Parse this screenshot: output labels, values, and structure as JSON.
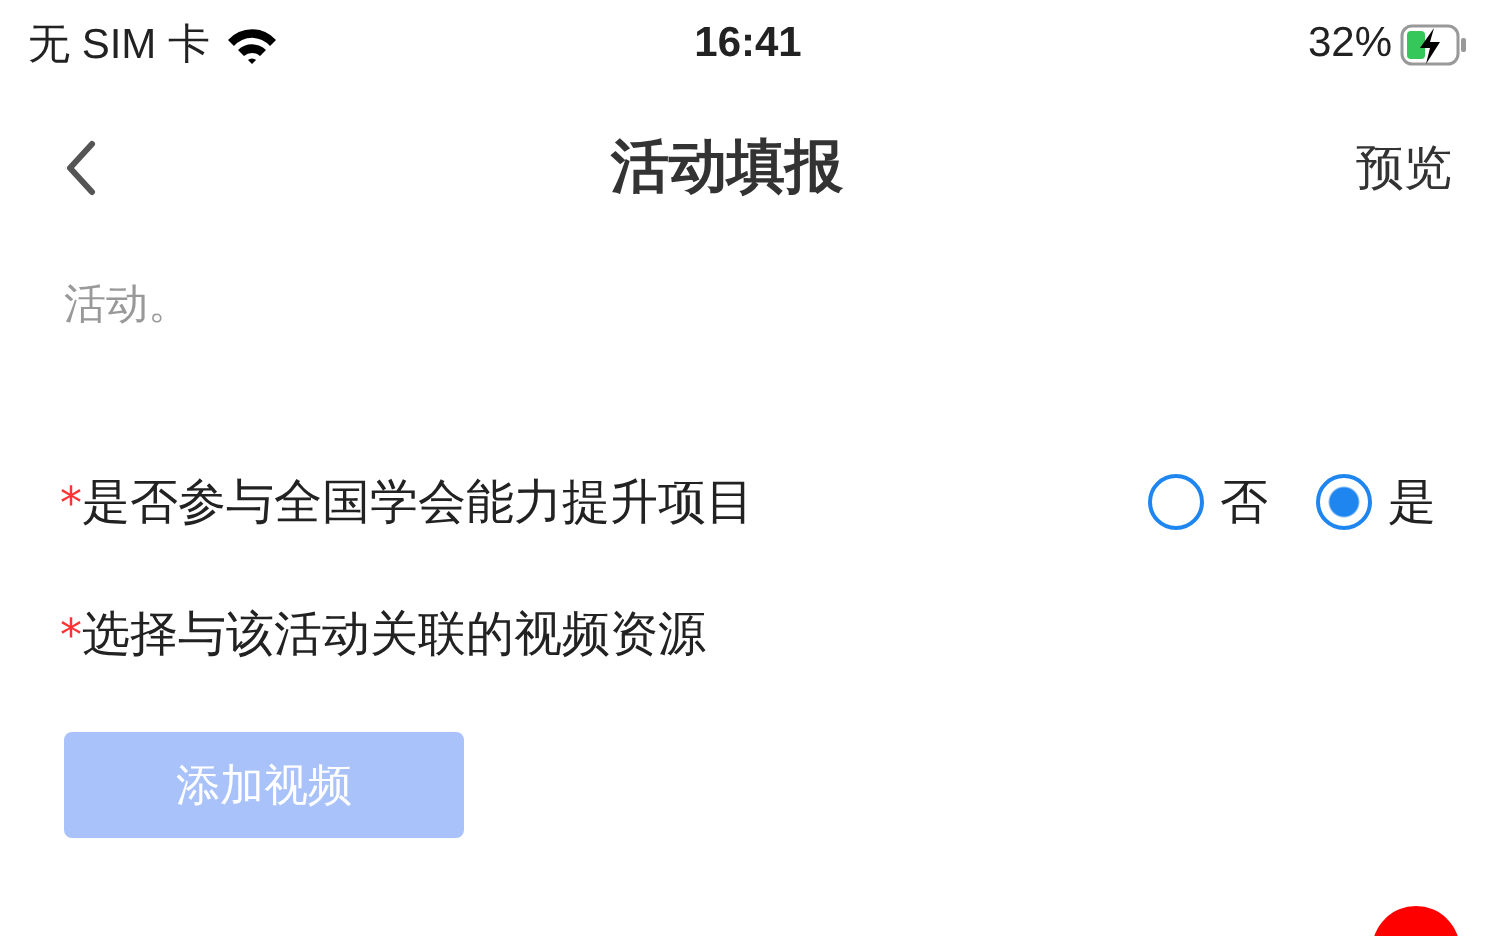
{
  "status_bar": {
    "carrier": "无 SIM 卡",
    "time": "16:41",
    "battery": "32%",
    "charging": true
  },
  "nav": {
    "title": "活动填报",
    "action": "预览"
  },
  "description": "活动。",
  "fields": [
    {
      "kind": "radio",
      "marker": "*",
      "label": "是否参与全国学会能力提升项目",
      "options": [
        {
          "label": "否",
          "selected": false
        },
        {
          "label": "是",
          "selected": true
        }
      ]
    },
    {
      "kind": "upload",
      "marker": "*",
      "label": "选择与该活动关联的视频资源",
      "button": {
        "label": "添加视频",
        "disabled": true
      }
    }
  ]
}
